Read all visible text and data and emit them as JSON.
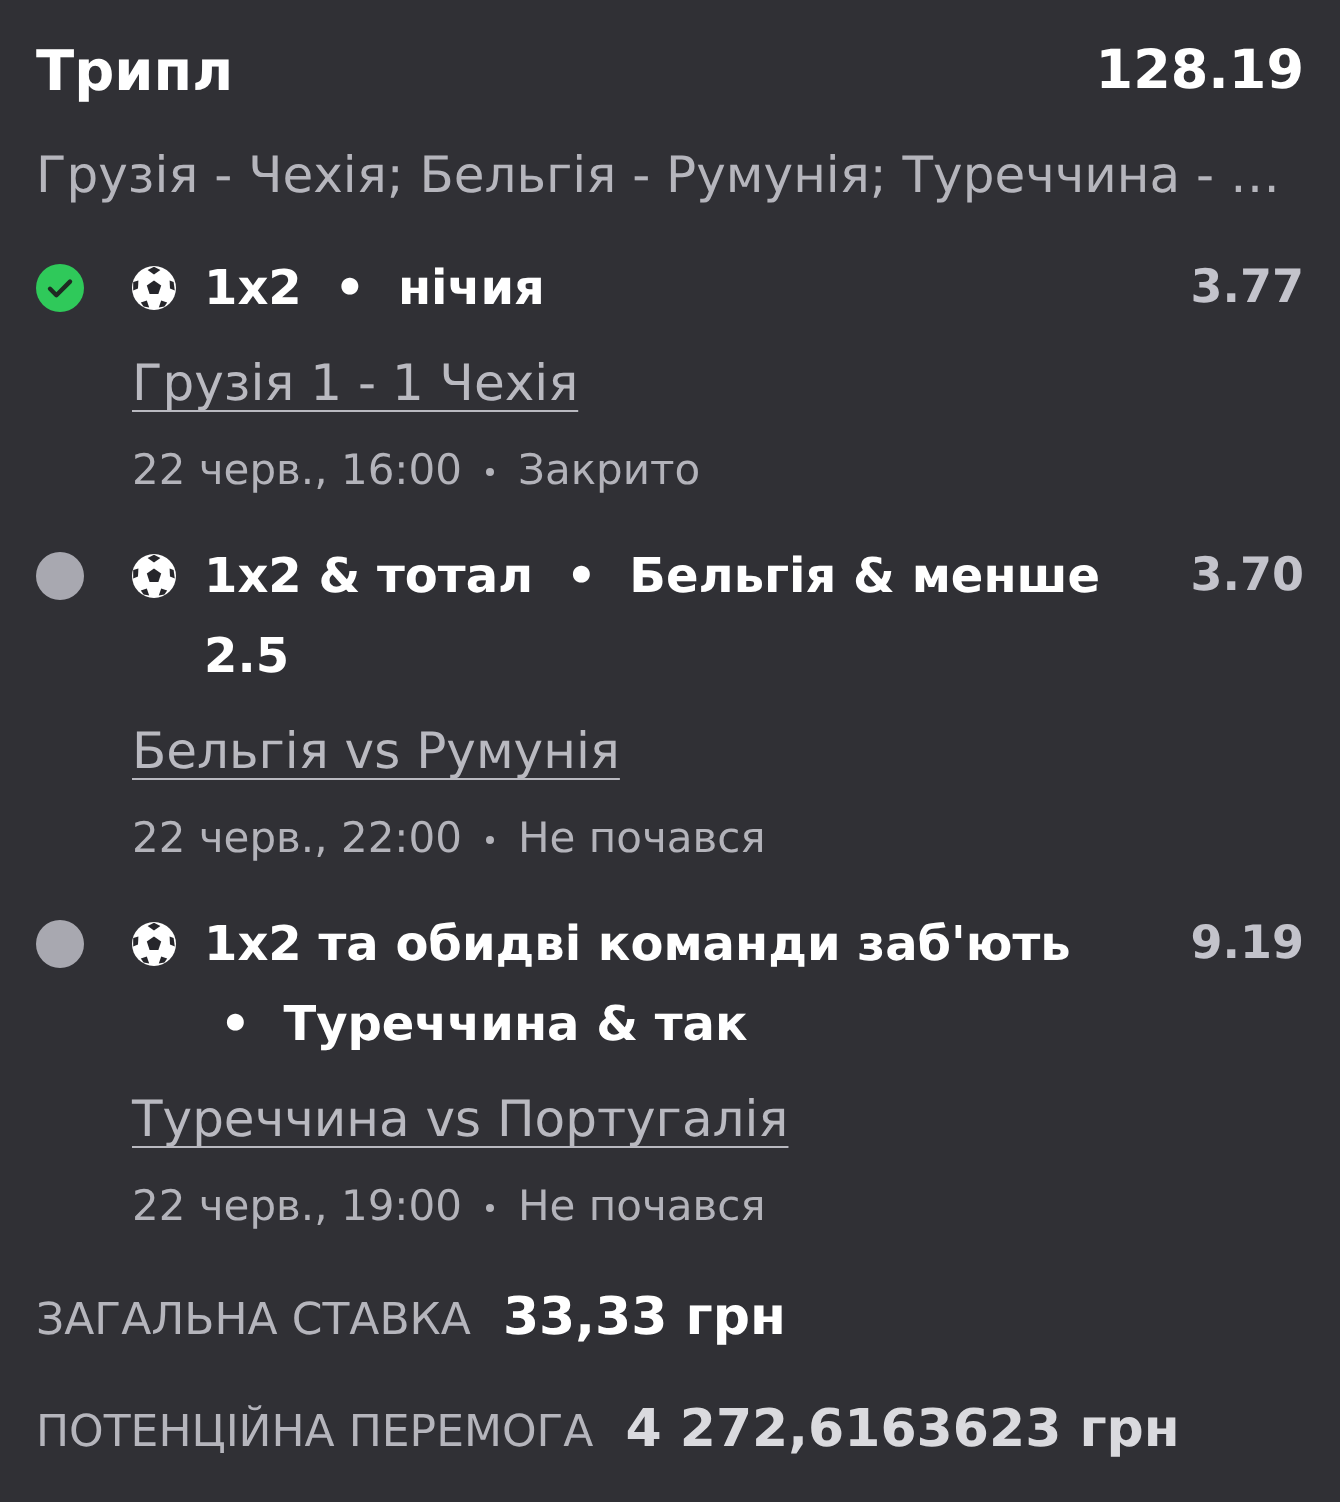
{
  "bet": {
    "type": "Трипл",
    "total_odds": "128.19",
    "events_summary": "Грузія - Чехія; Бельгія - Румунія; Туреччина - …"
  },
  "legs": [
    {
      "won": true,
      "market": "1x2",
      "separator": "•",
      "selection": "нічия",
      "odds": "3.77",
      "match": "Грузія 1 - 1 Чехія",
      "date": "22 черв., 16:00",
      "state": "Закрито"
    },
    {
      "won": false,
      "market": "1x2 & тотал",
      "separator": "•",
      "selection": "Бельгія & менше 2.5",
      "odds": "3.70",
      "match": "Бельгія vs Румунія",
      "date": "22 черв., 22:00",
      "state": "Не почався"
    },
    {
      "won": false,
      "market": "1x2 та обидві команди заб'ють",
      "separator": "•",
      "selection": "Туреччина & так",
      "odds": "9.19",
      "match": "Туреччина vs Португалія",
      "date": "22 черв., 19:00",
      "state": "Не почався"
    }
  ],
  "summary": [
    {
      "kind": "stake",
      "label": "ЗАГАЛЬНА СТАВКА",
      "value": "33,33 грн"
    },
    {
      "kind": "payout",
      "label": "ПОТЕНЦІЙНА ПЕРЕМОГА",
      "value": "4 272,6163623 грн"
    }
  ]
}
